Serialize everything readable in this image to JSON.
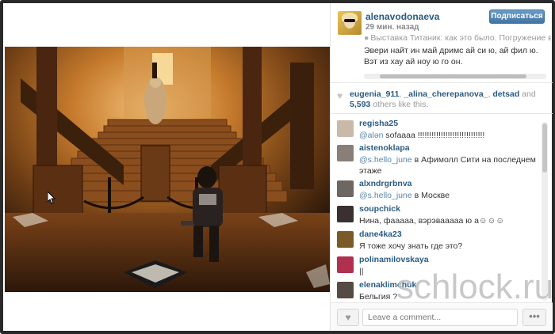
{
  "post": {
    "username": "alenavodonaeva",
    "time": "29 мин. назад",
    "follow_label": "Подписаться",
    "location": "Выставка Титаник: как это было. Погружение в ис",
    "caption": "Эвери найт ин май дримс ай си ю, ай фил ю. Вэт из хау ай ноу ю го он."
  },
  "likes": {
    "users": [
      "eugenia_911",
      "_alina_cherepanova_",
      "detsad"
    ],
    "sep1": ", ",
    "sep2": ", ",
    "and_word": " and ",
    "count": "5,593",
    "suffix": "others like this."
  },
  "comments": [
    {
      "user": "regisha25",
      "mention": "@alən",
      "text": " sofaaaa !!!!!!!!!!!!!!!!!!!!!!!!!!!!!",
      "avatar_color": "#c9b9a8"
    },
    {
      "user": "aistenoklapa",
      "mention": "@s.hello_june",
      "text": " в Афимолл Сити на последнем этаже",
      "avatar_color": "#8a7f78"
    },
    {
      "user": "alxndrgrbnva",
      "mention": "@s.hello_june",
      "text": " в Москве",
      "avatar_color": "#6e6660"
    },
    {
      "user": "soupchick",
      "mention": "",
      "text": "Нина, фааааа, вэрэвааааа ю а☺☺☺",
      "avatar_color": "#3a3030"
    },
    {
      "user": "dane4ka23",
      "mention": "",
      "text": "Я тоже хочу знать где это?",
      "avatar_color": "#7a5a28"
    },
    {
      "user": "polinamilovskaya",
      "mention": "",
      "text": "||",
      "avatar_color": "#b03050"
    },
    {
      "user": "elenaklimchuk",
      "mention": "",
      "text": "Бельгия ?",
      "avatar_color": "#554a44"
    }
  ],
  "footer": {
    "comment_placeholder": "Leave a comment...",
    "more_label": "•••"
  },
  "icons": {
    "heart": "♥",
    "pin": "⬤"
  },
  "watermark": "schlock.ru"
}
